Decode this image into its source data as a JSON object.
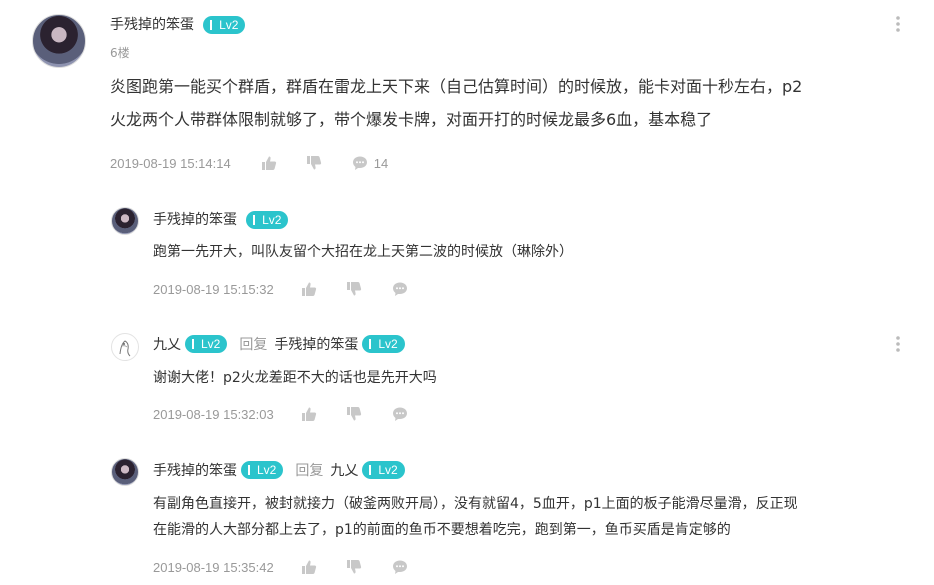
{
  "main_comment": {
    "author": "手残掉的笨蛋",
    "level": "Lv2",
    "floor": "6楼",
    "content_line1": "炎图跑第一能买个群盾，群盾在雷龙上天下来（自己估算时间）的时候放，能卡对面十秒左右，p2",
    "content_line2": "火龙两个人带群体限制就够了，带个爆发卡牌，对面开打的时候龙最多6血，基本稳了",
    "timestamp": "2019-08-19 15:14:14",
    "reply_count": "14"
  },
  "replies": [
    {
      "author": "手残掉的笨蛋",
      "level": "Lv2",
      "content_line1": "跑第一先开大，叫队友留个大招在龙上天第二波的时候放（琳除外）",
      "timestamp": "2019-08-19 15:15:32"
    },
    {
      "author": "九乂",
      "level": "Lv2",
      "reply_word": "回复",
      "reply_to": "手残掉的笨蛋",
      "reply_to_level": "Lv2",
      "content_line1": "谢谢大佬！p2火龙差距不大的话也是先开大吗",
      "timestamp": "2019-08-19 15:32:03"
    },
    {
      "author": "手残掉的笨蛋",
      "level": "Lv2",
      "reply_word": "回复",
      "reply_to": "九乂",
      "reply_to_level": "Lv2",
      "content_line1": "有副角色直接开，被封就接力（破釜两败开局），没有就留4，5血开，p1上面的板子能滑尽量滑，反正现",
      "content_line2": "在能滑的人大部分都上去了，p1的前面的鱼币不要想着吃完，跑到第一，鱼币买盾是肯定够的",
      "timestamp": "2019-08-19 15:35:42"
    }
  ],
  "icons": {
    "like": "thumbs-up-icon",
    "dislike": "thumbs-down-icon",
    "comment": "comment-bubble-icon",
    "more": "vertical-ellipsis-icon"
  },
  "colors": {
    "level_badge": "#2bc4cc",
    "meta_text": "#999999",
    "body_text": "#333333"
  }
}
